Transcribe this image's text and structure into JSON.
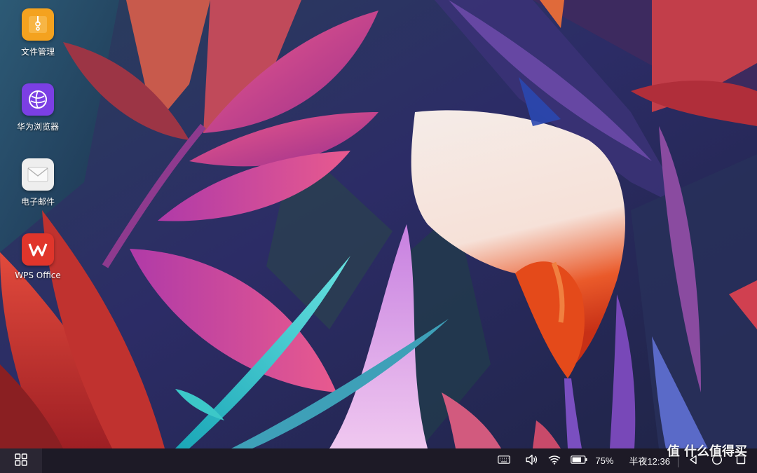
{
  "desktop": {
    "icons": [
      {
        "label": "文件管理",
        "icon": "folder-icon",
        "color": "#f4a21f"
      },
      {
        "label": "华为浏览器",
        "icon": "browser-globe-icon",
        "color": "#7b3fe4"
      },
      {
        "label": "电子邮件",
        "icon": "envelope-icon",
        "color": "#eeeeee"
      },
      {
        "label": "WPS Office",
        "icon": "wps-icon",
        "color": "#e0352b"
      }
    ]
  },
  "taskbar": {
    "start_icon": "app-grid-icon",
    "tray": {
      "keyboard_icon": "keyboard-icon",
      "volume_icon": "volume-icon",
      "wifi_icon": "wifi-icon",
      "battery_icon": "battery-icon",
      "battery_percent": "75%",
      "clock": "半夜12:36"
    },
    "nav": {
      "back_icon": "back-icon",
      "home_icon": "home-icon",
      "recents_icon": "recents-icon"
    }
  },
  "watermark": "值 什么值得买"
}
